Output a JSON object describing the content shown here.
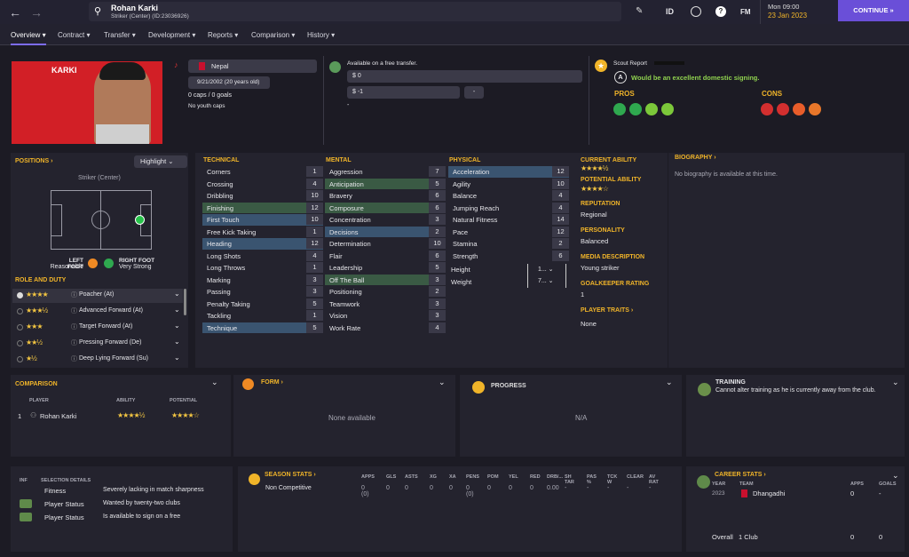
{
  "header": {
    "player_name": "Rohan Karki",
    "player_sub": "Striker (Center) (ID:23036926)",
    "id_label": "ID",
    "fm_label": "FM",
    "date_day": "Mon 09:00",
    "date": "23 Jan 2023",
    "continue": "CONTINUE"
  },
  "tabs": [
    "Overview",
    "Contract",
    "Transfer",
    "Development",
    "Reports",
    "Comparison",
    "History"
  ],
  "profile": {
    "surname": "KARKI",
    "nation": "Nepal",
    "dob": "9/21/2002 (20 years old)",
    "caps": "0 caps / 0 goals",
    "youth_caps": "No youth caps"
  },
  "contract": {
    "status": "Available on a free transfer.",
    "wage": "$ 0",
    "value": "$ -1",
    "value_btn": "-",
    "misc": "-"
  },
  "scout": {
    "title": "Scout Report",
    "grade": "A",
    "verdict": "Would be an excellent domestic signing.",
    "pros": "PROS",
    "cons": "CONS",
    "pro_colors": [
      "#2fa84f",
      "#2fa84f",
      "#7cc83a",
      "#7cc83a"
    ],
    "con_colors": [
      "#d32f2f",
      "#d32f2f",
      "#e85d2a",
      "#e8772a"
    ]
  },
  "positions": {
    "title": "POSITIONS",
    "highlight": "Highlight",
    "position_label": "Striker (Center)",
    "left_foot_label": "LEFT FOOT",
    "left_foot": "Reasonable",
    "right_foot_label": "RIGHT FOOT",
    "right_foot": "Very Strong"
  },
  "role_duty": {
    "title": "ROLE AND DUTY",
    "roles": [
      {
        "name": "Poacher (At)",
        "stars": "★★★★"
      },
      {
        "name": "Advanced Forward (At)",
        "stars": "★★★½"
      },
      {
        "name": "Target Forward (At)",
        "stars": "★★★"
      },
      {
        "name": "Pressing Forward (De)",
        "stars": "★★½"
      },
      {
        "name": "Deep Lying Forward (Su)",
        "stars": "★½"
      }
    ]
  },
  "technical": {
    "title": "TECHNICAL",
    "attrs": [
      {
        "n": "Corners",
        "v": "1"
      },
      {
        "n": "Crossing",
        "v": "4"
      },
      {
        "n": "Dribbling",
        "v": "10"
      },
      {
        "n": "Finishing",
        "v": "12"
      },
      {
        "n": "First Touch",
        "v": "10"
      },
      {
        "n": "Free Kick Taking",
        "v": "1"
      },
      {
        "n": "Heading",
        "v": "12"
      },
      {
        "n": "Long Shots",
        "v": "4"
      },
      {
        "n": "Long Throws",
        "v": "1"
      },
      {
        "n": "Marking",
        "v": "3"
      },
      {
        "n": "Passing",
        "v": "3"
      },
      {
        "n": "Penalty Taking",
        "v": "5"
      },
      {
        "n": "Tackling",
        "v": "1"
      },
      {
        "n": "Technique",
        "v": "5"
      }
    ]
  },
  "mental": {
    "title": "MENTAL",
    "attrs": [
      {
        "n": "Aggression",
        "v": "7"
      },
      {
        "n": "Anticipation",
        "v": "5"
      },
      {
        "n": "Bravery",
        "v": "6"
      },
      {
        "n": "Composure",
        "v": "6"
      },
      {
        "n": "Concentration",
        "v": "3"
      },
      {
        "n": "Decisions",
        "v": "2"
      },
      {
        "n": "Determination",
        "v": "10"
      },
      {
        "n": "Flair",
        "v": "6"
      },
      {
        "n": "Leadership",
        "v": "5"
      },
      {
        "n": "Off The Ball",
        "v": "3"
      },
      {
        "n": "Positioning",
        "v": "2"
      },
      {
        "n": "Teamwork",
        "v": "3"
      },
      {
        "n": "Vision",
        "v": "3"
      },
      {
        "n": "Work Rate",
        "v": "4"
      }
    ]
  },
  "physical": {
    "title": "PHYSICAL",
    "attrs": [
      {
        "n": "Acceleration",
        "v": "12"
      },
      {
        "n": "Agility",
        "v": "10"
      },
      {
        "n": "Balance",
        "v": "4"
      },
      {
        "n": "Jumping Reach",
        "v": "4"
      },
      {
        "n": "Natural Fitness",
        "v": "14"
      },
      {
        "n": "Pace",
        "v": "12"
      },
      {
        "n": "Stamina",
        "v": "2"
      },
      {
        "n": "Strength",
        "v": "6"
      }
    ],
    "height_label": "Height",
    "height": "1...",
    "weight_label": "Weight",
    "weight": "7..."
  },
  "summary": {
    "ca_label": "CURRENT ABILITY",
    "ca_stars": "★★★★½",
    "pa_label": "POTENTIAL ABILITY",
    "pa_stars": "★★★★☆",
    "rep_label": "REPUTATION",
    "rep": "Regional",
    "pers_label": "PERSONALITY",
    "pers": "Balanced",
    "media_label": "MEDIA DESCRIPTION",
    "media": "Young striker",
    "gk_label": "GOALKEEPER RATING",
    "gk": "1",
    "traits_label": "PLAYER TRAITS",
    "traits": "None"
  },
  "biography": {
    "title": "BIOGRAPHY",
    "text": "No biography is available at this time."
  },
  "comparison": {
    "title": "COMPARISON",
    "col_player": "PLAYER",
    "col_ability": "ABILITY",
    "col_potential": "POTENTIAL",
    "rank": "1",
    "name": "Rohan Karki",
    "ability": "★★★★½",
    "potential": "★★★★☆"
  },
  "form": {
    "title": "FORM",
    "text": "None available"
  },
  "progress": {
    "title": "PROGRESS",
    "text": "N/A"
  },
  "training": {
    "title": "TRAINING",
    "text": "Cannot alter training as he is currently away from the club."
  },
  "selection": {
    "inf": "INF",
    "title": "SELECTION DETAILS",
    "rows": [
      {
        "label": "Fitness",
        "text": "Severely lacking in match sharpness"
      },
      {
        "label": "Player Status",
        "text": "Wanted by twenty-two clubs"
      },
      {
        "label": "Player Status",
        "text": "Is available to sign on a free"
      }
    ]
  },
  "season": {
    "title": "SEASON STATS",
    "headers": [
      "APPS",
      "GLS",
      "ASTS",
      "XG",
      "XA",
      "PENS",
      "POM",
      "YEL",
      "RED",
      "DRB/...",
      "SH TAR",
      "PAS %",
      "TCK W",
      "CLEAR",
      "AV RAT"
    ],
    "row_label": "Non Competitive",
    "values": [
      "0 (0)",
      "0",
      "0",
      "0",
      "0",
      "0 (0)",
      "0",
      "0",
      "0",
      "0.00",
      "-",
      "-",
      "-",
      "-",
      "-"
    ]
  },
  "career": {
    "title": "CAREER STATS",
    "col_year": "YEAR",
    "col_team": "TEAM",
    "col_apps": "APPS",
    "col_goals": "GOALS",
    "year": "2023",
    "team": "Dhangadhi",
    "apps": "0",
    "goals": "-",
    "overall_label": "Overall",
    "overall_clubs": "1 Club",
    "overall_apps": "0",
    "overall_goals": "0"
  }
}
